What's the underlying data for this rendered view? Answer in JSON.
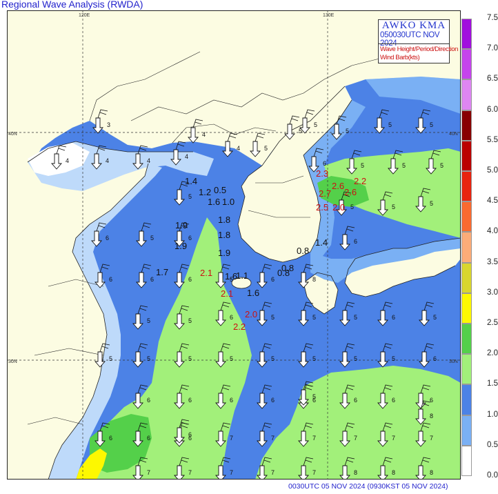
{
  "title": "Regional Wave Analysis (RWDA)",
  "footer": "0030UTC 05 NOV 2024 (0930KST 05 NOV 2024)",
  "infobox": {
    "agency": "AWKO  KMA",
    "time": "050030UTC NOV 2024",
    "legend_wave": "Wave Height/Period/Direction",
    "legend_wind": "Wind Barb(kts)"
  },
  "grid_labels": {
    "lon_120": "120E",
    "lon_130": "130E",
    "lat_40_left": "40N",
    "lat_40_right": "40N",
    "lat_30_left": "30N",
    "lat_30_right": "30N"
  },
  "colorbar": {
    "labels": [
      "7.5",
      "7.0",
      "6.5",
      "6.0",
      "5.5",
      "5.0",
      "4.5",
      "4.0",
      "3.5",
      "3.0",
      "2.5",
      "2.0",
      "1.5",
      "1.0",
      "0.5",
      "0.0"
    ],
    "colors": [
      "#a10fde",
      "#c544ec",
      "#de86f2",
      "#880000",
      "#bb0000",
      "#e82410",
      "#fa6a30",
      "#fcac78",
      "#d9d62e",
      "#fdf800",
      "#54d04a",
      "#a2f07a",
      "#4c82e6",
      "#7ab0f4",
      "#bedafa",
      "#ffffff"
    ]
  },
  "map_colors": {
    "land": "#fcfce2",
    "sea_lt05": "#ffffff",
    "sea_05_10": "#bedafa",
    "sea_10_15": "#7ab0f4",
    "sea_15_20": "#4c82e6",
    "sea_20_25": "#a2f07a",
    "sea_25_30": "#54d04a",
    "sea_30_35": "#fdf800"
  },
  "height_labels": [
    {
      "text": "1.4",
      "color": "#111111"
    },
    {
      "text": "1.2",
      "color": "#111111"
    },
    {
      "text": "0.5",
      "color": "#111111"
    },
    {
      "text": "1.6",
      "color": "#111111"
    },
    {
      "text": "1.0",
      "color": "#111111"
    },
    {
      "text": "1.9",
      "color": "#111111"
    },
    {
      "text": "1.8",
      "color": "#111111"
    },
    {
      "text": "1.8",
      "color": "#111111"
    },
    {
      "text": "1.9",
      "color": "#111111"
    },
    {
      "text": "1.9",
      "color": "#111111"
    },
    {
      "text": "1.7",
      "color": "#111111"
    },
    {
      "text": "2.1",
      "color": "#cc1111"
    },
    {
      "text": "1.6",
      "color": "#111111"
    },
    {
      "text": "1.1",
      "color": "#111111"
    },
    {
      "text": "0.8",
      "color": "#111111"
    },
    {
      "text": "0.8",
      "color": "#111111"
    },
    {
      "text": "1.6",
      "color": "#111111"
    },
    {
      "text": "2.1",
      "color": "#cc1111"
    },
    {
      "text": "2.0",
      "color": "#cc1111"
    },
    {
      "text": "2.2",
      "color": "#cc1111"
    },
    {
      "text": "1.4",
      "color": "#111111"
    },
    {
      "text": "0.8",
      "color": "#111111"
    },
    {
      "text": "2.3",
      "color": "#cc1111"
    },
    {
      "text": "2.6",
      "color": "#cc1111"
    },
    {
      "text": "2.2",
      "color": "#cc1111"
    },
    {
      "text": "2.7",
      "color": "#cc1111"
    },
    {
      "text": "2.6",
      "color": "#cc1111"
    },
    {
      "text": "2.5",
      "color": "#cc1111"
    },
    {
      "text": "2.0",
      "color": "#cc1111"
    }
  ],
  "period_labels": [
    "3",
    "4",
    "4",
    "4",
    "4",
    "4",
    "4",
    "5",
    "5",
    "5",
    "5",
    "5",
    "5",
    "6",
    "5",
    "5",
    "5",
    "5",
    "5",
    "5",
    "5",
    "5",
    "6",
    "6",
    "6",
    "6",
    "6",
    "6",
    "5",
    "5",
    "5",
    "6",
    "5",
    "5",
    "5",
    "5",
    "5",
    "5",
    "5",
    "5",
    "5",
    "5",
    "5",
    "6",
    "6",
    "6",
    "6",
    "6",
    "6",
    "6",
    "6",
    "6",
    "6",
    "6",
    "6",
    "7",
    "7",
    "7",
    "7",
    "7",
    "7",
    "7",
    "7",
    "7",
    "7",
    "7",
    "8",
    "8",
    "8",
    "8",
    "8",
    "6",
    "6",
    "5",
    "6",
    "5",
    "5"
  ]
}
